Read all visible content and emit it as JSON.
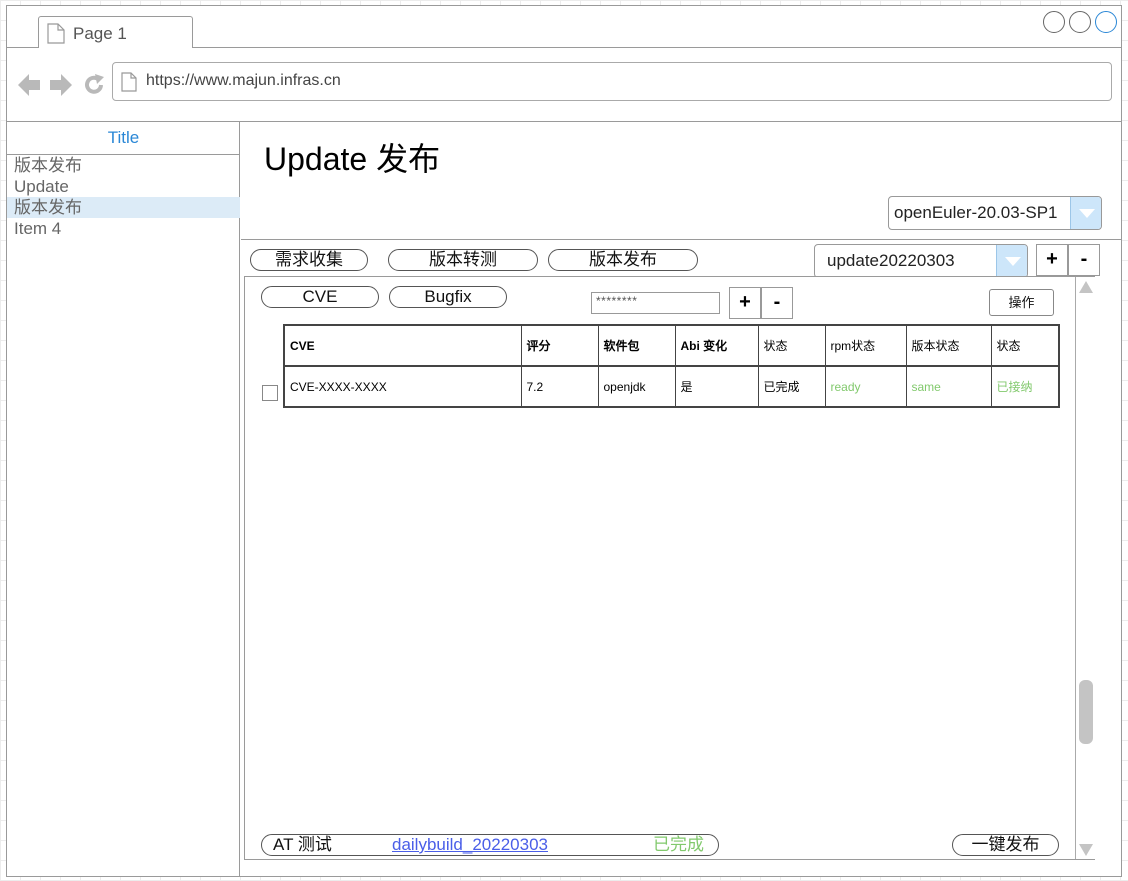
{
  "browser": {
    "tab_label": "Page 1",
    "url": "https://www.majun.infras.cn"
  },
  "sidebar": {
    "title": "Title",
    "items": [
      {
        "label": "版本发布",
        "selected": false
      },
      {
        "label": "Update",
        "selected": false
      },
      {
        "label": "版本发布",
        "selected": true
      },
      {
        "label": "Item 4",
        "selected": false
      }
    ]
  },
  "header": {
    "title": "Update 发布",
    "release_select": "openEuler-20.03-SP1"
  },
  "stages": {
    "collect_label": "需求收集",
    "test_label": "版本转测",
    "publish_label": "版本发布",
    "update_select": "update20220303",
    "add_label": "+",
    "remove_label": "-"
  },
  "panel": {
    "tabs": {
      "cve_label": "CVE",
      "bugfix_label": "Bugfix"
    },
    "search_value": "********",
    "add_label": "+",
    "remove_label": "-",
    "action_label": "操作"
  },
  "table": {
    "headers": [
      "CVE",
      "评分",
      "软件包",
      "Abi 变化",
      "状态",
      "rpm状态",
      "版本状态",
      "状态"
    ],
    "rows": [
      {
        "cve": "CVE-XXXX-XXXX",
        "score": "7.2",
        "package": "openjdk",
        "abi_change": "是",
        "status": "已完成",
        "rpm_status": "ready",
        "version_status": "same",
        "accept_status": "已接纳"
      }
    ]
  },
  "footer": {
    "at_label": "AT 测试",
    "build_link": "dailybuild_20220303",
    "build_status": "已完成",
    "publish_button": "一键发布"
  },
  "colors": {
    "accent": "#2a87d6",
    "success": "#82c96d",
    "link": "#4a5ee8",
    "select_arrow": "#cde6fa"
  }
}
